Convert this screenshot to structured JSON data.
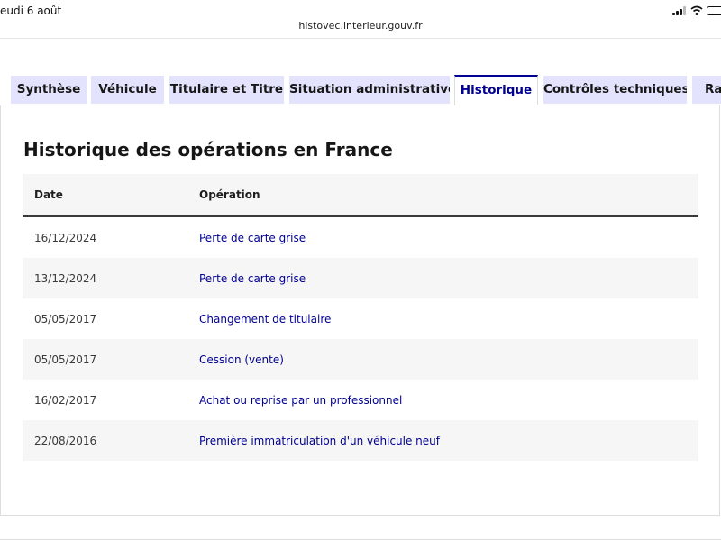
{
  "status": {
    "time": "eudi 6 août"
  },
  "browser": {
    "url": "histovec.interieur.gouv.fr"
  },
  "tabs": [
    {
      "label": "Synthèse"
    },
    {
      "label": "Véhicule"
    },
    {
      "label": "Titulaire et Titre"
    },
    {
      "label": "Situation administrative"
    },
    {
      "label": "Historique"
    },
    {
      "label": "Contrôles techniques"
    },
    {
      "label": "Rap"
    }
  ],
  "active_tab": "Historique",
  "history": {
    "title": "Historique des opérations en France",
    "columns": {
      "date": "Date",
      "operation": "Opération"
    },
    "rows": [
      {
        "date": "16/12/2024",
        "operation": "Perte de carte grise"
      },
      {
        "date": "13/12/2024",
        "operation": "Perte de carte grise"
      },
      {
        "date": "05/05/2017",
        "operation": "Changement de titulaire"
      },
      {
        "date": "05/05/2017",
        "operation": "Cession (vente)"
      },
      {
        "date": "16/02/2017",
        "operation": "Achat ou reprise par un professionnel"
      },
      {
        "date": "22/08/2016",
        "operation": "Première immatriculation d'un véhicule neuf"
      }
    ]
  },
  "colors": {
    "accent": "#000091",
    "tab_bg": "#e3e3fd",
    "row_alt": "#f6f6f6"
  }
}
